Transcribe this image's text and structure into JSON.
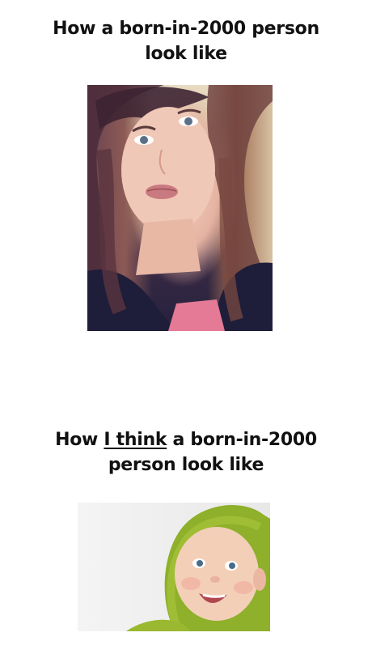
{
  "captions": {
    "first": {
      "line1": "How a born-in-2000 person",
      "line2": "look like"
    },
    "second": {
      "line1_prefix": "How ",
      "line1_emphasis": "I think",
      "line1_suffix": " a born-in-2000",
      "line2": "person look like"
    }
  },
  "photos": {
    "first": {
      "subject": "young-woman-selfie"
    },
    "second": {
      "subject": "smiling-baby-in-green-hood"
    }
  }
}
